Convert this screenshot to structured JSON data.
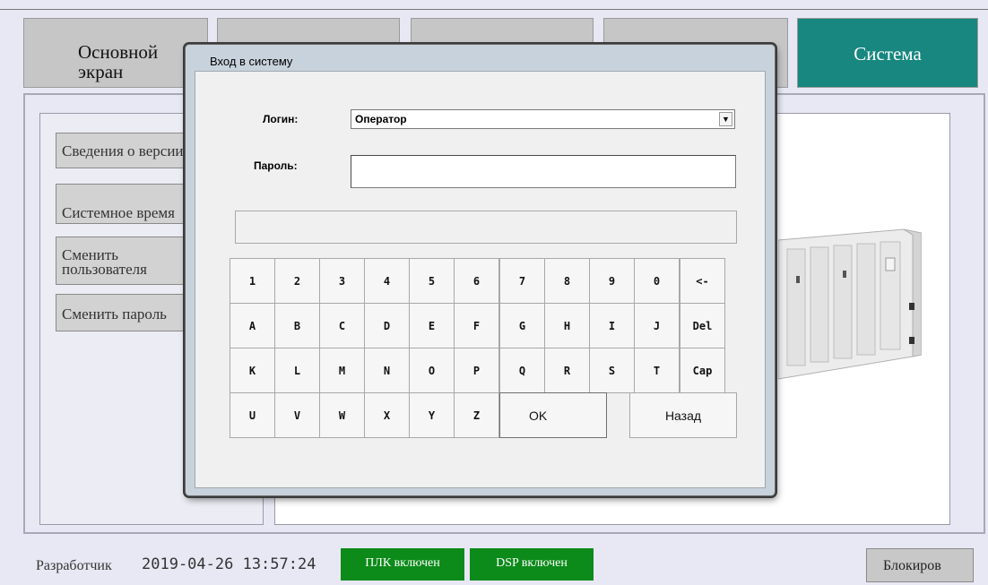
{
  "nav": {
    "main_line1": "Основной",
    "main_line2": "экран",
    "system": "Система"
  },
  "sidebar": {
    "items": [
      {
        "label": "Сведения о версии"
      },
      {
        "label": "Системное время"
      },
      {
        "label_line1": "Сменить",
        "label_line2": "пользователя"
      },
      {
        "label": "Сменить пароль"
      }
    ]
  },
  "dialog": {
    "title": "Вход в систему",
    "login_label": "Логин:",
    "login_value": "Оператор",
    "password_label": "Пароль:",
    "keyboard": {
      "row1": [
        "1",
        "2",
        "3",
        "4",
        "5",
        "6",
        "7",
        "8",
        "9",
        "0",
        "<-"
      ],
      "row2": [
        "A",
        "B",
        "C",
        "D",
        "E",
        "F",
        "G",
        "H",
        "I",
        "J",
        "Del"
      ],
      "row3": [
        "K",
        "L",
        "M",
        "N",
        "O",
        "P",
        "Q",
        "R",
        "S",
        "T",
        "Cap"
      ],
      "row4": [
        "U",
        "V",
        "W",
        "X",
        "Y",
        "Z"
      ],
      "ok": "OK",
      "back": "Назад"
    }
  },
  "status": {
    "role": "Разработчик",
    "datetime": "2019-04-26 13:57:24",
    "plc": "ПЛК включен",
    "dsp": "DSP включен",
    "lock": "Блокиров"
  },
  "colors": {
    "system_tab": "#17877f",
    "status_green": "#0c8a1a"
  }
}
